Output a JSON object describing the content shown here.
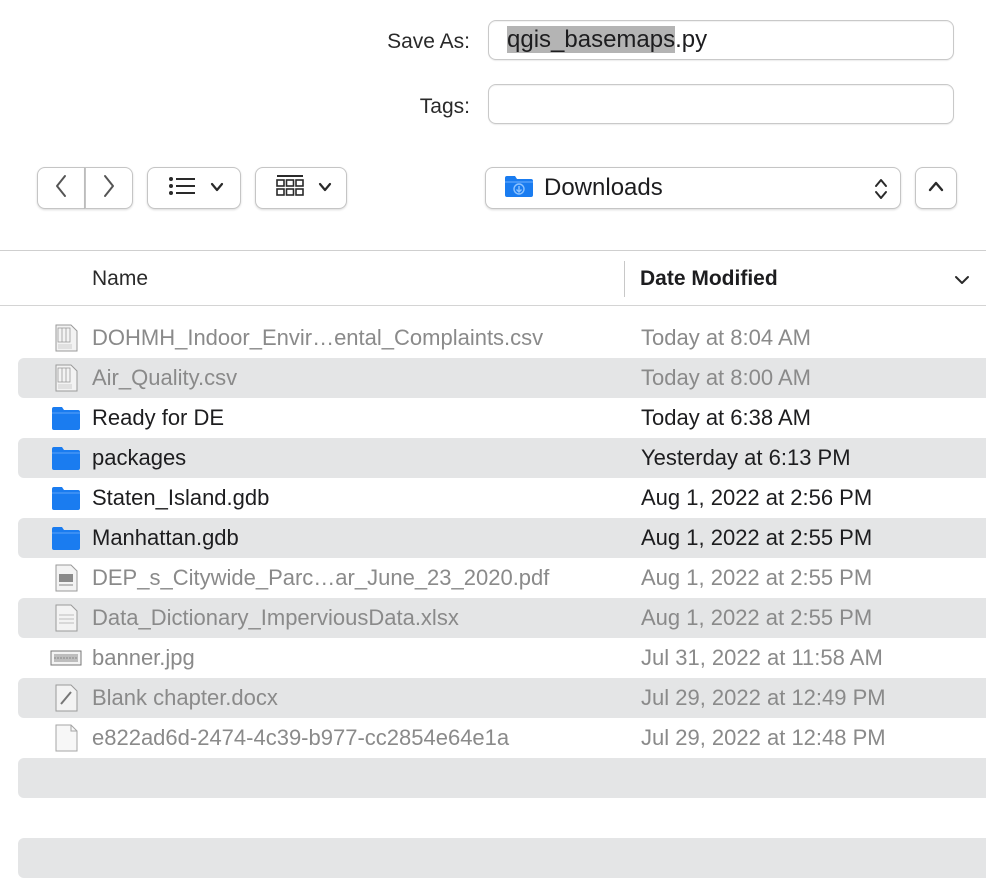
{
  "save_as": {
    "label": "Save As:",
    "value_selected": "qgis_basemaps",
    "value_ext": ".py"
  },
  "tags": {
    "label": "Tags:",
    "value": ""
  },
  "toolbar": {
    "back_icon": "chevron-left-icon",
    "forward_icon": "chevron-right-icon",
    "list_view_icon": "list-icon",
    "group_icon": "grid-icon",
    "location": "Downloads",
    "location_icon": "folder-icon",
    "expand_icon": "chevron-up-icon"
  },
  "columns": {
    "name": "Name",
    "date_modified": "Date Modified"
  },
  "files": [
    {
      "name": "DOHMH_Indoor_Envir…ental_Complaints.csv",
      "date": "Today at 8:04 AM",
      "icon": "csv-file-icon",
      "dim": true
    },
    {
      "name": "Air_Quality.csv",
      "date": "Today at 8:00 AM",
      "icon": "csv-file-icon",
      "dim": true
    },
    {
      "name": "Ready for DE",
      "date": "Today at 6:38 AM",
      "icon": "folder-icon",
      "dim": false
    },
    {
      "name": "packages",
      "date": "Yesterday at 6:13 PM",
      "icon": "folder-icon",
      "dim": false
    },
    {
      "name": "Staten_Island.gdb",
      "date": "Aug 1, 2022 at 2:56 PM",
      "icon": "folder-icon",
      "dim": false
    },
    {
      "name": "Manhattan.gdb",
      "date": "Aug 1, 2022 at 2:55 PM",
      "icon": "folder-icon",
      "dim": false
    },
    {
      "name": "DEP_s_Citywide_Parc…ar_June_23_2020.pdf",
      "date": "Aug 1, 2022 at 2:55 PM",
      "icon": "pdf-file-icon",
      "dim": true
    },
    {
      "name": "Data_Dictionary_ImperviousData.xlsx",
      "date": "Aug 1, 2022 at 2:55 PM",
      "icon": "spreadsheet-file-icon",
      "dim": true
    },
    {
      "name": "banner.jpg",
      "date": "Jul 31, 2022 at 11:58 AM",
      "icon": "image-file-icon",
      "dim": true
    },
    {
      "name": "Blank chapter.docx",
      "date": "Jul 29, 2022 at 12:49 PM",
      "icon": "document-file-icon",
      "dim": true
    },
    {
      "name": "e822ad6d-2474-4c39-b977-cc2854e64e1a",
      "date": "Jul 29, 2022 at 12:48 PM",
      "icon": "blank-file-icon",
      "dim": true
    }
  ],
  "colors": {
    "folder": "#1a7cf0",
    "selection": "#b4b4b4",
    "stripe": "#e4e5e6"
  }
}
